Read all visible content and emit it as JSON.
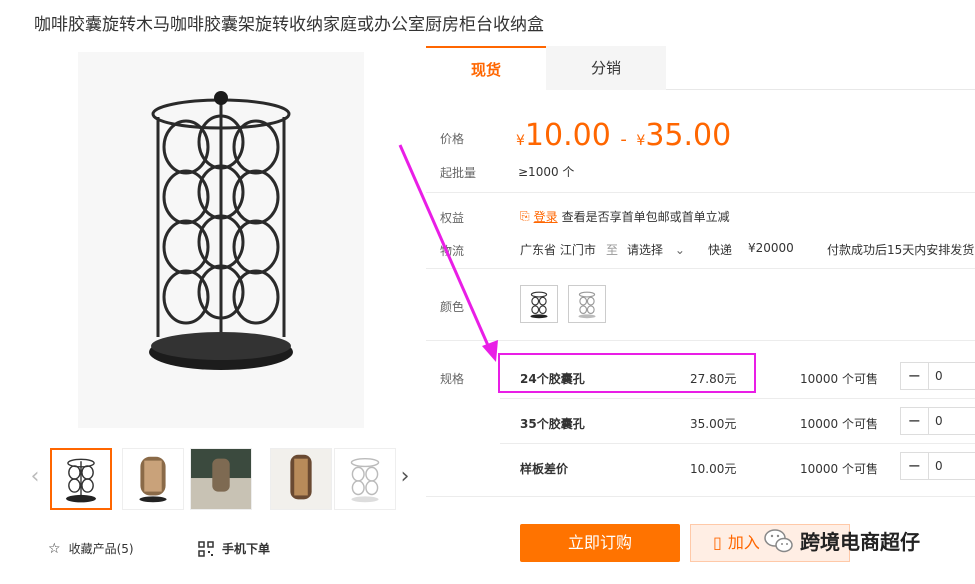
{
  "title": "咖啡胶囊旋转木马咖啡胶囊架旋转收纳家庭或办公室厨房柜台收纳盒",
  "tabs": [
    {
      "label": "现货"
    },
    {
      "label": "分销"
    }
  ],
  "price": {
    "label": "价格",
    "currency": "¥",
    "low": "10.00",
    "separator": "-",
    "high": "35.00"
  },
  "moq": {
    "label": "起批量",
    "value": "≥1000 个"
  },
  "rights": {
    "label": "权益",
    "login": "登录",
    "text": "查看是否享首单包邮或首单立减"
  },
  "logistics": {
    "label": "物流",
    "origin": "广东省 江门市",
    "to": "至",
    "select": "请选择",
    "method": "快递",
    "fee": "¥20000",
    "delivery": "付款成功后15天内安排发货"
  },
  "color": {
    "label": "颜色"
  },
  "specs": {
    "label": "规格",
    "rows": [
      {
        "name": "24个胶囊孔",
        "price": "27.80元",
        "stock": "10000 个可售",
        "qty": "0"
      },
      {
        "name": "35个胶囊孔",
        "price": "35.00元",
        "stock": "10000 个可售",
        "qty": "0"
      },
      {
        "name": "样板差价",
        "price": "10.00元",
        "stock": "10000 个可售",
        "qty": "0"
      }
    ]
  },
  "actions": {
    "favorite": "收藏产品(5)",
    "mobile": "手机下单",
    "buy": "立即订购",
    "cart": "加入"
  },
  "watermark": "跨境电商超仔",
  "colors": {
    "accent": "#ff6600",
    "highlight": "#e91ee6"
  }
}
